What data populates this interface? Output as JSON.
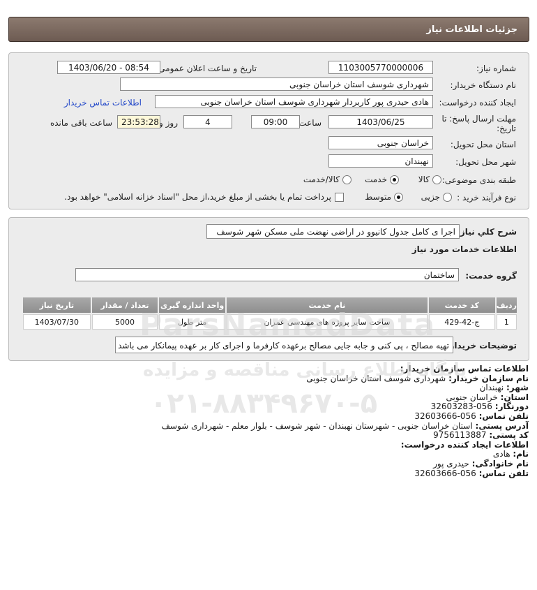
{
  "title": "جزئیات اطلاعات نیاز",
  "labels": {
    "need_number": "شماره نیاز:",
    "announce": "تاریخ و ساعت اعلان عمومی:",
    "buyer_org": "نام دستگاه خریدار:",
    "creator": "ایجاد کننده درخواست:",
    "deadline": "مهلت ارسال پاسخ: تا تاریخ:",
    "time_word": "ساعت",
    "days_word": "روز و",
    "remaining": "ساعت باقی مانده",
    "province": "استان محل تحویل:",
    "city": "شهر محل تحویل:",
    "category": "طبقه بندی موضوعی:",
    "process": "نوع فرآیند خرید :",
    "description": "شرح کلي نیاز:",
    "services_info": "اطلاعات خدمات مورد نیاز",
    "service_group": "گروه خدمت:",
    "buyer_notes": "توضیحات خریدار:"
  },
  "values": {
    "need_number": "1103005770000006",
    "announce": "1403/06/20 - 08:54",
    "buyer_org": "شهرداری شوسف استان خراسان جنوبی",
    "creator": "هادی حیدری پور کاربردار شهرداری شوسف استان خراسان جنوبی",
    "contact_link": "اطلاعات تماس خریدار",
    "deadline_date": "1403/06/25",
    "deadline_time": "09:00",
    "days": "4",
    "remaining_time": "23:53:28",
    "province": "خراسان جنوبی",
    "city": "نهبندان",
    "description": "اجرا ی کامل جدول کانیوو در اراضی نهضت ملی مسکن شهر شوسف",
    "service_group": "ساختمان",
    "buyer_notes": "تهیه مصالح ، پی کنی و جابه جایی مصالح برعهده کارفرما و اجرای کار بر عهده پیمانکار می باشد"
  },
  "category_options": [
    {
      "label": "کالا",
      "selected": false
    },
    {
      "label": "خدمت",
      "selected": true
    },
    {
      "label": "کالا/خدمت",
      "selected": false
    }
  ],
  "process_options": [
    {
      "label": "جزیی",
      "selected": false
    },
    {
      "label": "متوسط",
      "selected": true
    }
  ],
  "payment_note": "پرداخت تمام یا بخشی از مبلغ خرید،از محل \"اسناد خزانه اسلامی\" خواهد بود.",
  "table": {
    "headers": [
      "ردیف",
      "کد خدمت",
      "نام خدمت",
      "واحد اندازه گیری",
      "تعداد / مقدار",
      "تاریخ نیاز"
    ],
    "rows": [
      [
        "1",
        "ج-42-429",
        "ساخت سایر پروژه های مهندسی عمران",
        "متر طول",
        "5000",
        "1403/07/30"
      ]
    ]
  },
  "contact": {
    "header": "اطلاعات تماس سازمان خریدار:",
    "org_label": "نام سازمان خریدار:",
    "org": "شهرداری شوسف استان خراسان جنوبی",
    "city_label": "شهر:",
    "city": "نهبندان",
    "province_label": "استان:",
    "province": "خراسان جنوبی",
    "fax_label": "دورنگار:",
    "fax": "056-32603283",
    "phone_label": "تلفن تماس:",
    "phone": "056-32603666",
    "address_label": "آدرس پستی:",
    "address": "استان خراسان جنوبی - شهرستان نهبندان - شهر شوسف - بلوار معلم - شهرداری شوسف",
    "postal_label": "کد پستی:",
    "postal": "9756113887",
    "creator_header": "اطلاعات ایجاد کننده درخواست:",
    "name_label": "نام:",
    "name": "هادی",
    "family_label": "نام خانوادگی:",
    "family": "حیدری پور",
    "creator_phone_label": "تلفن تماس:",
    "creator_phone": "056-32603666"
  },
  "watermark": {
    "brand": "ParsNamadData",
    "site": "پایگاه اطلاع رسانی مناقصه و مزایده",
    "phone": "۰۲۱-۸۸۳۴۹۶۷۰-۵"
  },
  "colors": {
    "titlebar": "#7a675d",
    "panel": "#ececec",
    "link": "#2449c9",
    "remaining_bg": "#fdf8d9"
  }
}
